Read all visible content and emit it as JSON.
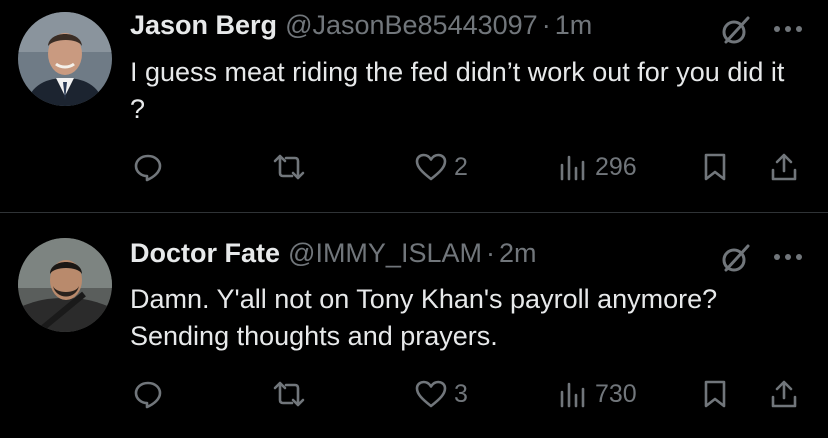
{
  "tweets": [
    {
      "author_name": "Jason Berg",
      "handle": "@JasonBe85443097",
      "separator": "·",
      "time": "1m",
      "text": "I guess meat riding the fed didn’t work out for you did it ?",
      "likes": "2",
      "views": "296"
    },
    {
      "author_name": "Doctor Fate",
      "handle": "@IMMY_ISLAM",
      "separator": "·",
      "time": "2m",
      "text": "Damn. Y'all not on Tony Khan's payroll anymore? Sending thoughts and prayers.",
      "likes": "3",
      "views": "730"
    }
  ],
  "icons": {
    "reply": "reply-icon",
    "retweet": "retweet-icon",
    "like": "heart-icon",
    "views": "views-chart-icon",
    "bookmark": "bookmark-icon",
    "share": "share-icon",
    "grok": "grok-icon",
    "more": "more-dots-icon"
  },
  "colors": {
    "background": "#000000",
    "primary_text": "#e7e9ea",
    "secondary_text": "#71767b",
    "divider": "#2f3336"
  }
}
